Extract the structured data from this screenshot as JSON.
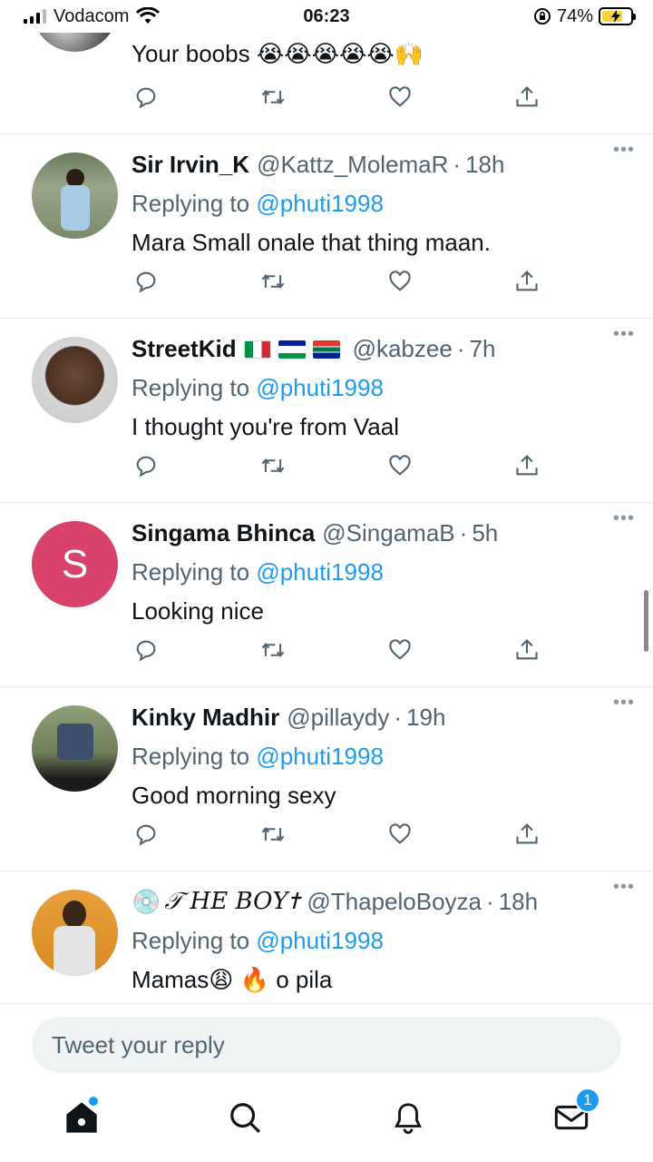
{
  "status_bar": {
    "carrier": "Vodacom",
    "time": "06:23",
    "battery": "74%",
    "battery_level": 0.74
  },
  "tweets": [
    {
      "text": "Your boobs",
      "emoji": "😭😭😭😭😭🙌"
    },
    {
      "name": "Sir Irvin_K",
      "handle": "@Kattz_MolemaR",
      "time": "18h",
      "replying_label": "Replying to",
      "mention": "@phuti1998",
      "text": "Mara Small onale that thing maan."
    },
    {
      "name": "StreetKid",
      "handle": "@kabzee",
      "time": "7h",
      "replying_label": "Replying to",
      "mention": "@phuti1998",
      "text": "I thought you're from Vaal"
    },
    {
      "name": "Singama Bhinca",
      "handle": "@SingamaB",
      "time": "5h",
      "replying_label": "Replying to",
      "mention": "@phuti1998",
      "text": "Looking nice",
      "avatar_letter": "S",
      "avatar_color": "#d9426a"
    },
    {
      "name": "Kinky Madhir",
      "handle": "@pillaydy",
      "time": "19h",
      "replying_label": "Replying to",
      "mention": "@phuti1998",
      "text": "Good morning sexy"
    },
    {
      "name": "𝒯 HE BOY✝",
      "name_prefix_emoji": "💿",
      "handle": "@ThapeloBoyza",
      "time": "18h",
      "replying_label": "Replying to",
      "mention": "@phuti1998",
      "text_a": "Mamas",
      "emoji_a": "😩",
      "emoji_b": "🔥",
      "text_b": "o pila"
    }
  ],
  "reply": {
    "placeholder": "Tweet your reply"
  },
  "nav": {
    "messages_badge": "1"
  },
  "colors": {
    "link": "#1d9bf0",
    "secondary": "#536471",
    "divider": "#e6ecf0"
  }
}
